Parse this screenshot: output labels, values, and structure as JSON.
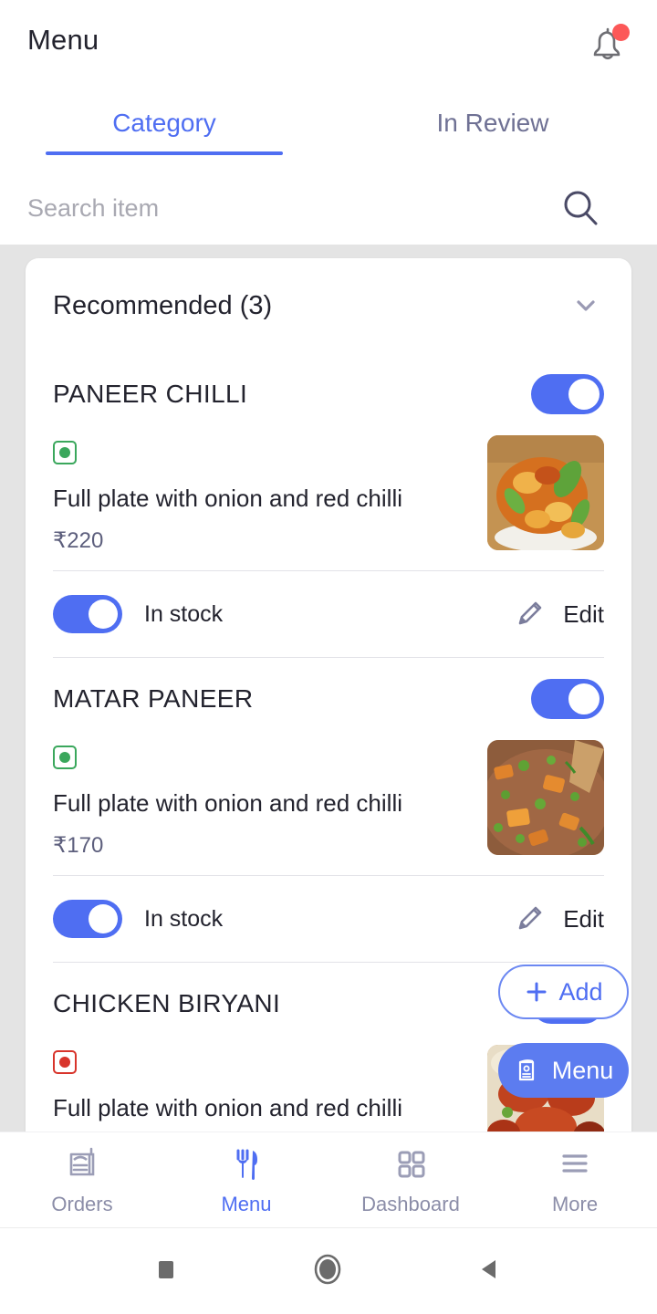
{
  "header": {
    "title": "Menu",
    "bell_icon": "notification-bell-icon",
    "has_unread_dot": true
  },
  "tabs": [
    {
      "label": "Category",
      "active": true
    },
    {
      "label": "In Review",
      "active": false
    }
  ],
  "search": {
    "placeholder": "Search item",
    "value": "",
    "icon": "search-icon"
  },
  "category": {
    "title": "Recommended  (3)",
    "name": "Recommended",
    "count": "(3)",
    "expanded": true,
    "chevron_icon": "chevron-down-icon"
  },
  "items": [
    {
      "name": "PANEER CHILLI",
      "description": "Full plate with onion and red chilli",
      "price": "₹220",
      "diet": "veg",
      "enabled": true,
      "stock_label": "In stock",
      "in_stock": true,
      "edit_label": "Edit",
      "edit_icon": "pencil-icon",
      "thumb_alt": "paneer-chilli-photo"
    },
    {
      "name": "MATAR PANEER",
      "description": "Full plate with onion and red chilli",
      "price": "₹170",
      "diet": "veg",
      "enabled": true,
      "stock_label": "In stock",
      "in_stock": true,
      "edit_label": "Edit",
      "edit_icon": "pencil-icon",
      "thumb_alt": "matar-paneer-photo"
    },
    {
      "name": "CHICKEN BIRYANI",
      "description": "Full plate with onion and red chilli",
      "price": "",
      "diet": "nonveg",
      "enabled": true,
      "stock_label": "",
      "in_stock": true,
      "edit_label": "",
      "edit_icon": "pencil-icon",
      "thumb_alt": "chicken-biryani-photo"
    }
  ],
  "fab": {
    "add_label": "Add",
    "add_icon": "plus-icon",
    "menu_label": "Menu",
    "menu_icon": "menu-book-icon"
  },
  "bottom_nav": [
    {
      "label": "Orders",
      "icon": "receipt-icon",
      "active": false
    },
    {
      "label": "Menu",
      "icon": "fork-knife-icon",
      "active": true
    },
    {
      "label": "Dashboard",
      "icon": "grid-icon",
      "active": false
    },
    {
      "label": "More",
      "icon": "hamburger-menu-icon",
      "active": false
    }
  ],
  "system_nav": [
    {
      "name": "recents-button",
      "icon": "square-icon"
    },
    {
      "name": "home-button",
      "icon": "circle-icon"
    },
    {
      "name": "back-button",
      "icon": "triangle-left-icon"
    }
  ],
  "colors": {
    "accent": "#4f6ef2",
    "toggle_on": "#4f6ef2",
    "veg": "#3aa75c",
    "nonveg": "#d8342b",
    "badge_red": "#fc5858",
    "background": "#e4e4e4",
    "muted_text": "#8b8da8"
  }
}
